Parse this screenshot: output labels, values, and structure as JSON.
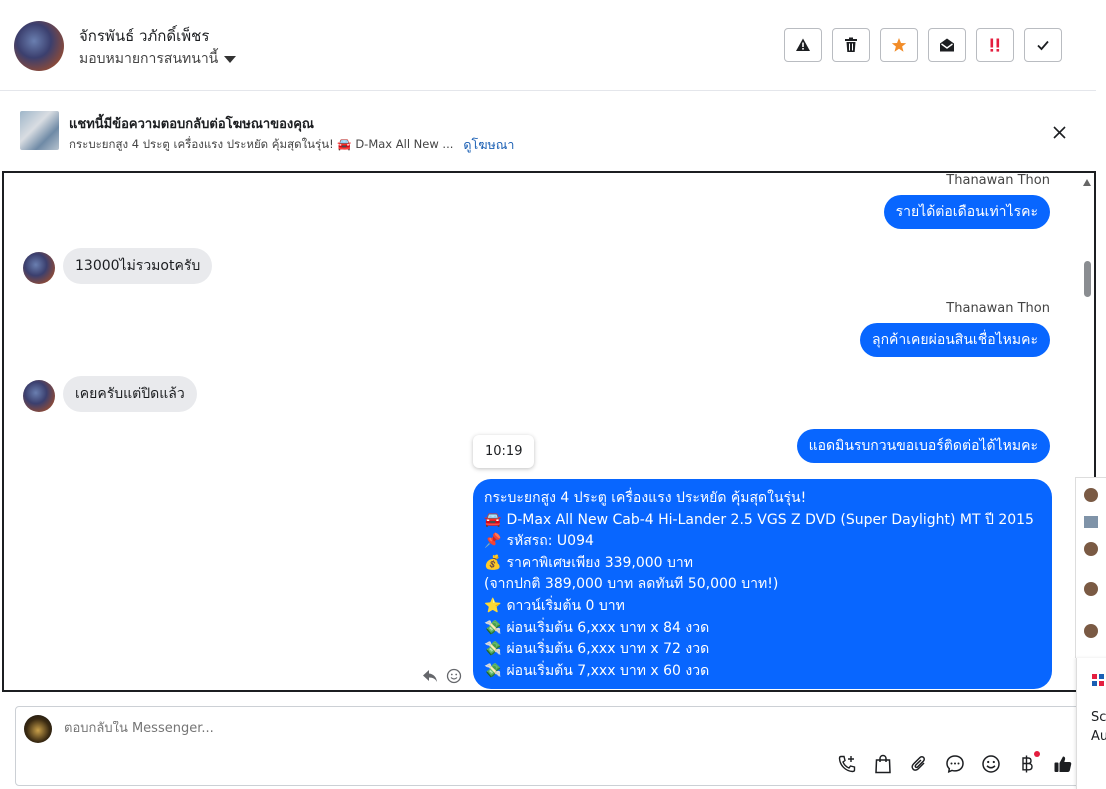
{
  "header": {
    "contact_name": "จักรพันธ์ วภักดิ์เพ็ชร",
    "assign_label": "มอบหมายการสนทนานี้"
  },
  "actions": [
    {
      "name": "warning-icon",
      "color": "#1c1e21"
    },
    {
      "name": "trash-icon",
      "color": "#1c1e21"
    },
    {
      "name": "star-icon",
      "color": "#f28c28"
    },
    {
      "name": "envelope-open-icon",
      "color": "#1c1e21"
    },
    {
      "name": "urgent-icon",
      "color": "#e41e3f"
    },
    {
      "name": "check-icon",
      "color": "#1c1e21"
    }
  ],
  "banner": {
    "title": "แชทนี้มีข้อความตอบกลับต่อโฆษณาของคุณ",
    "ad_text": "กระบะยกสูง 4 ประตู เครื่องแรง ประหยัด คุ้มสุดในรุ่น! 🚘 D-Max All New ...",
    "link_label": "ดูโฆษณา"
  },
  "messages": {
    "m1_sender": "Thanawan Thon",
    "m1_text": "รายได้ต่อเดือนเท่าไรคะ",
    "m2_text": "13000ไม่รวมotครับ",
    "m3_sender": "Thanawan Thon",
    "m3_text": "ลุกค้าเคยผ่อนสินเชื่อไหมคะ",
    "m4_text": "เคยครับแต่ปิดแล้ว",
    "m5_text": "แอดมินรบกวนขอเบอร์ติดต่อได้ไหมคะ",
    "time_tip": "10:19",
    "listing_lines": [
      {
        "emoji": "",
        "text": "กระบะยกสูง 4 ประตู เครื่องแรง ประหยัด คุ้มสุดในรุ่น!"
      },
      {
        "emoji": "🚘",
        "text": "D-Max All New Cab-4 Hi-Lander 2.5 VGS Z DVD (Super Daylight) MT ปี 2015"
      },
      {
        "emoji": "📌",
        "text": "รหัสรถ: U094"
      },
      {
        "emoji": "💰",
        "text": "ราคาพิเศษเพียง 339,000 บาท"
      },
      {
        "emoji": "",
        "text": "(จากปกติ 389,000 บาท ลดทันที 50,000 บาท!)"
      },
      {
        "emoji": "⭐",
        "text": "ดาวน์เริ่มต้น 0 บาท"
      },
      {
        "emoji": "💸",
        "text": "ผ่อนเริ่มต้น 6,xxx บาท x 84 งวด"
      },
      {
        "emoji": "💸",
        "text": "ผ่อนเริ่มต้น 6,xxx บาท x 72 งวด"
      },
      {
        "emoji": "💸",
        "text": "ผ่อนเริ่มต้น 7,xxx บาท x 60 งวด"
      }
    ]
  },
  "composer": {
    "placeholder": "ตอบกลับใน Messenger..."
  },
  "sidecard": {
    "line1": "Sc",
    "line2": "Au"
  },
  "colors": {
    "outgoing_bubble": "#0866ff",
    "incoming_bubble": "#e9eaed",
    "link": "#1a5fb4"
  }
}
